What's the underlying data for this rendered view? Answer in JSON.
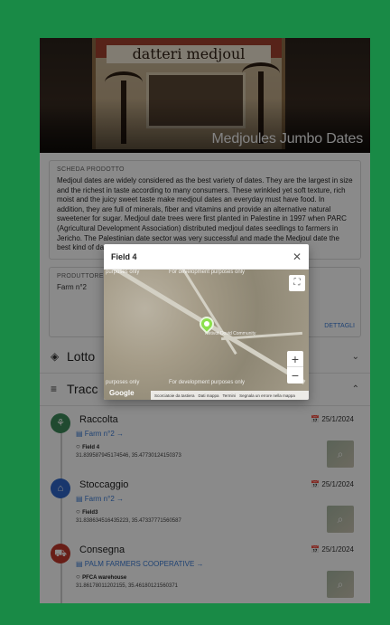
{
  "hero": {
    "product_title": "Medjoules Jumbo Dates",
    "package_label": "datteri medjoul"
  },
  "product_card": {
    "section_label": "SCHEDA PRODOTTO",
    "description": "Medjoul dates are widely considered as the best variety of dates. They are the largest in size and the richest in taste according to many consumers. These wrinkled yet soft texture, rich moist and the juicy sweet taste make medjoul dates an everyday must have food. In addition, they are full of minerals, fiber and vitamins and provide an alternative natural sweetener for sugar. Medjoul date trees were first planted in Palestine in 1997 when PARC (Agricultural Development Association) distributed medjoul dates seedlings to farmers in Jericho. The Palestinian date sector was very successful and made the Medjoul date the best kind of dates"
  },
  "producer": {
    "label": "PRODUTTORE",
    "value": "Farm n°2",
    "details_link": "DETTAGLI"
  },
  "sections": {
    "lotto": "Lotto",
    "tracciabilita": "Tracc"
  },
  "timeline": [
    {
      "title": "Raccolta",
      "date": "25/1/2024",
      "actor": "Farm n°2",
      "place": "Field 4",
      "coords": "31.839587945174546, 35.47730124150373",
      "color": "#3c8a5a"
    },
    {
      "title": "Stoccaggio",
      "date": "25/1/2024",
      "actor": "Farm n°2",
      "place": "Field3",
      "coords": "31.838634516435223, 35.47337771560587",
      "color": "#2f66c9"
    },
    {
      "title": "Consegna",
      "date": "25/1/2024",
      "actor": "PALM FARMERS COOPERATIVE",
      "place": "PFCA warehouse",
      "coords": "31.86178011202155, 35.46180121560371",
      "color": "#c0392b"
    }
  ],
  "modal": {
    "title": "Field 4",
    "watermark": "For development purposes only",
    "watermark_left": "purposes only",
    "watermark_right": "purposes only",
    "google": "Google",
    "footer_items": [
      "Scorciatoie da tastiera",
      "Dati mappa",
      "Termini",
      "Segnala un errore nella mappa"
    ],
    "place_label": "Netivot Dovid Community"
  },
  "icons": {
    "lotto": "tag-icon",
    "tracciabilita": "list-icon",
    "close": "close-icon",
    "fullscreen": "fullscreen-icon",
    "zoom_in": "plus-icon",
    "zoom_out": "minus-icon"
  }
}
